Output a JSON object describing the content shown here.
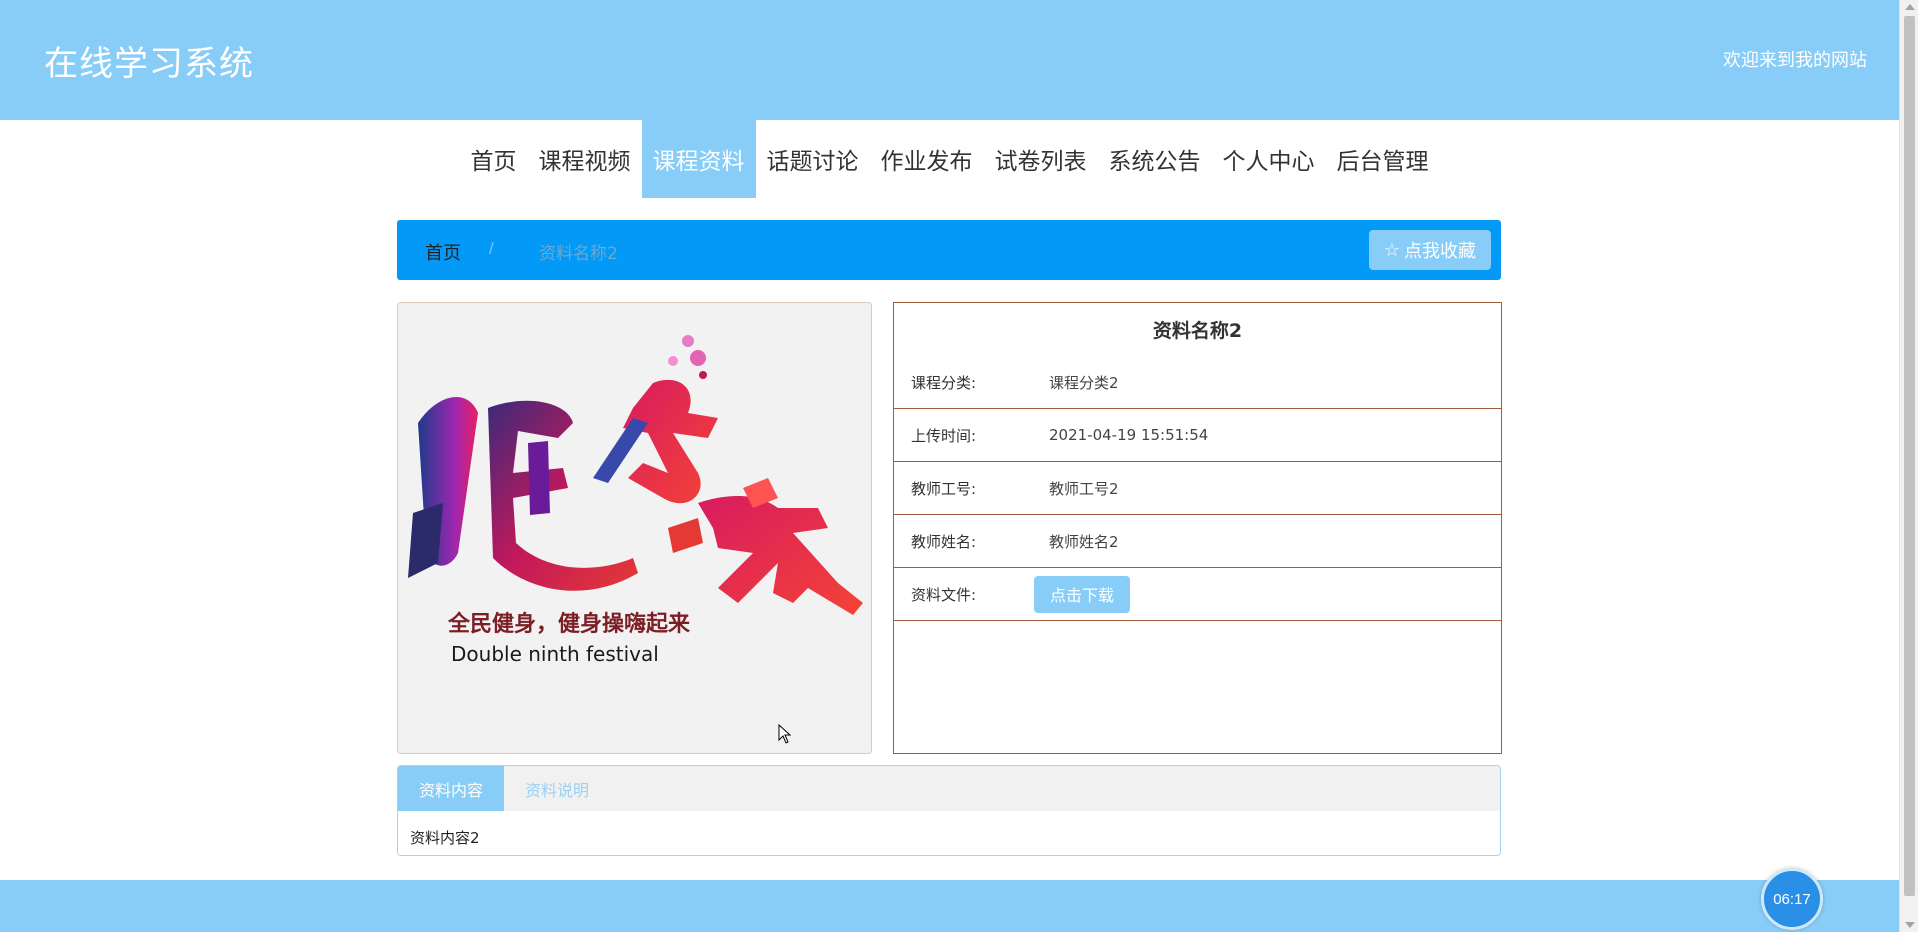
{
  "header": {
    "site_title": "在线学习系统",
    "welcome": "欢迎来到我的网站"
  },
  "nav": {
    "items": [
      {
        "label": "首页",
        "active": false
      },
      {
        "label": "课程视频",
        "active": false
      },
      {
        "label": "课程资料",
        "active": true
      },
      {
        "label": "话题讨论",
        "active": false
      },
      {
        "label": "作业发布",
        "active": false
      },
      {
        "label": "试卷列表",
        "active": false
      },
      {
        "label": "系统公告",
        "active": false
      },
      {
        "label": "个人中心",
        "active": false
      },
      {
        "label": "后台管理",
        "active": false
      }
    ]
  },
  "breadcrumb": {
    "home": "首页",
    "separator": "/",
    "current": "资料名称2",
    "favorite_label": "点我收藏",
    "favorite_icon": "star-outline-icon"
  },
  "image": {
    "poster_subtitle_cn": "全民健身，健身操嗨起来",
    "poster_subtitle_en": "Double ninth festival"
  },
  "detail": {
    "title": "资料名称2",
    "rows": [
      {
        "label": "课程分类:",
        "value": "课程分类2"
      },
      {
        "label": "上传时间:",
        "value": "2021-04-19 15:51:54"
      },
      {
        "label": "教师工号:",
        "value": "教师工号2"
      },
      {
        "label": "教师姓名:",
        "value": "教师姓名2"
      }
    ],
    "file_label": "资料文件:",
    "download_label": "点击下载"
  },
  "tabs": {
    "items": [
      {
        "label": "资料内容",
        "active": true
      },
      {
        "label": "资料说明",
        "active": false
      }
    ],
    "content": "资料内容2"
  },
  "timer": {
    "value": "06:17"
  },
  "colors": {
    "header_bg": "#87cdf7",
    "crumb_bg": "#0399f7",
    "detail_border": "#a35b3e"
  }
}
